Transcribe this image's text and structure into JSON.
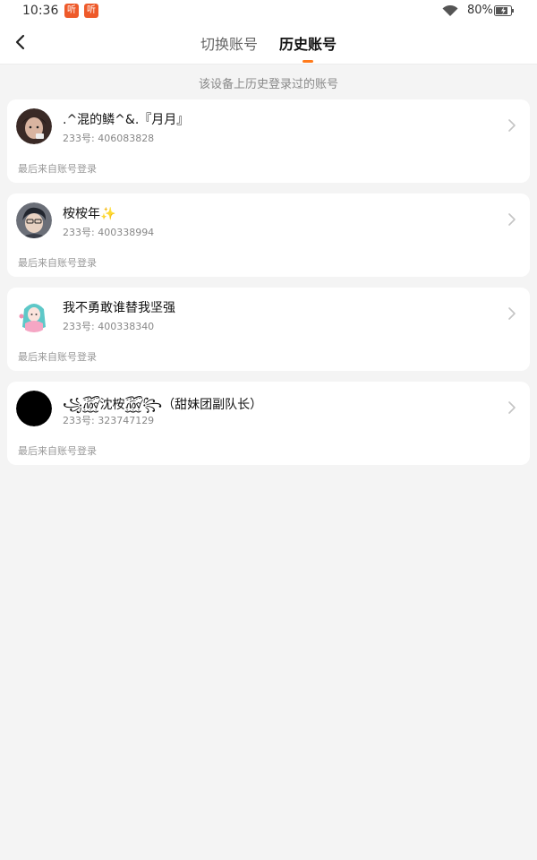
{
  "status_bar": {
    "time": "10:36",
    "notifications": [
      "听",
      "听"
    ],
    "battery": "80%",
    "icons": [
      "wifi-icon",
      "battery-charging-icon"
    ]
  },
  "nav": {
    "back_icon": "chevron-left-icon",
    "tabs": [
      {
        "label": "切换账号",
        "active": false
      },
      {
        "label": "历史账号",
        "active": true
      }
    ],
    "accent_color": "#ff7a1a"
  },
  "subtitle": "该设备上历史登录过的账号",
  "accounts": [
    {
      "nickname": ".^混的鳞^&.『月月』",
      "id_text": "233号: 406083828",
      "login_hint": "最后来自账号登录"
    },
    {
      "nickname": "桉桉年✨",
      "id_text": "233号: 400338994",
      "login_hint": "最后来自账号登录"
    },
    {
      "nickname": "我不勇敢谁替我坚强",
      "id_text": "233号: 400338340",
      "login_hint": "最后来自账号登录"
    },
    {
      "nickname": "꧁꫞沈桉꫞꧂（甜妹团副队长）",
      "id_text": "233号: 323747129",
      "login_hint": "最后来自账号登录"
    }
  ]
}
